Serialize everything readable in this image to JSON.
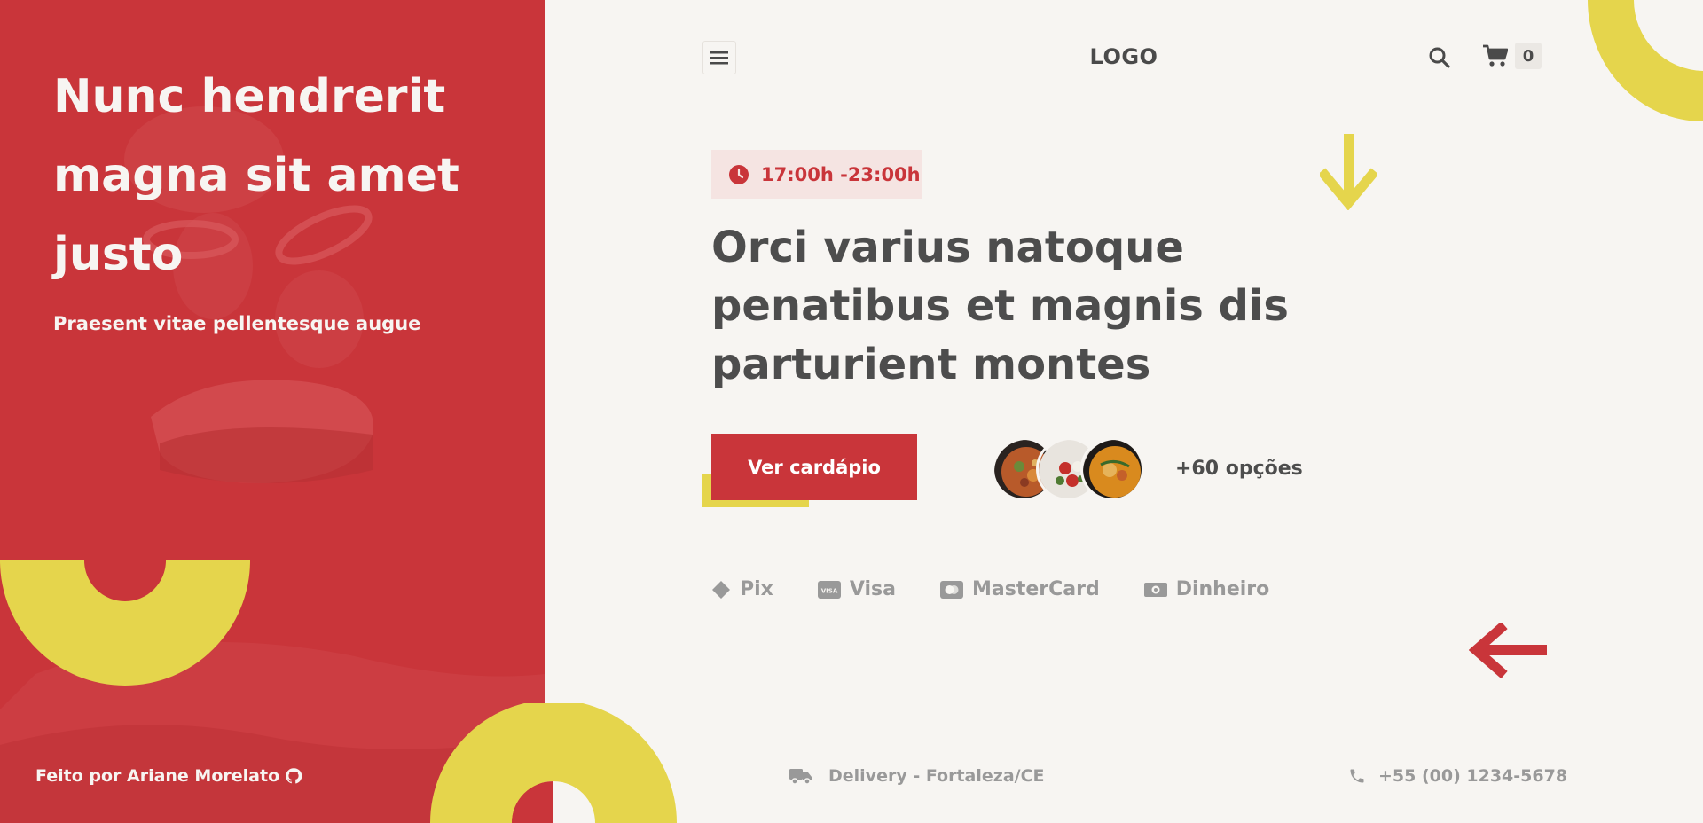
{
  "hero": {
    "title": "Nunc hendrerit magna sit amet justo",
    "subtitle": "Praesent vitae pellentesque augue",
    "credit": "Feito por Ariane Morelato"
  },
  "header": {
    "logo": "LOGO",
    "cart_count": "0"
  },
  "main": {
    "hours": "17:00h -23:00h",
    "headline": "Orci varius natoque penatibus et magnis dis parturient montes",
    "cta_label": "Ver cardápio",
    "options_label": "+60 opções"
  },
  "payments": [
    {
      "label": "Pix",
      "icon": "pix-icon"
    },
    {
      "label": "Visa",
      "icon": "visa-icon"
    },
    {
      "label": "MasterCard",
      "icon": "mastercard-icon"
    },
    {
      "label": "Dinheiro",
      "icon": "money-icon"
    }
  ],
  "footer": {
    "delivery": "Delivery - Fortaleza/CE",
    "phone": "+55 (00) 1234-5678"
  },
  "colors": {
    "brand_red": "#c9353a",
    "accent_yellow": "#e5d54c",
    "background": "#f7f5f2",
    "text_dark": "#4d4d4d",
    "text_muted": "#999999"
  }
}
